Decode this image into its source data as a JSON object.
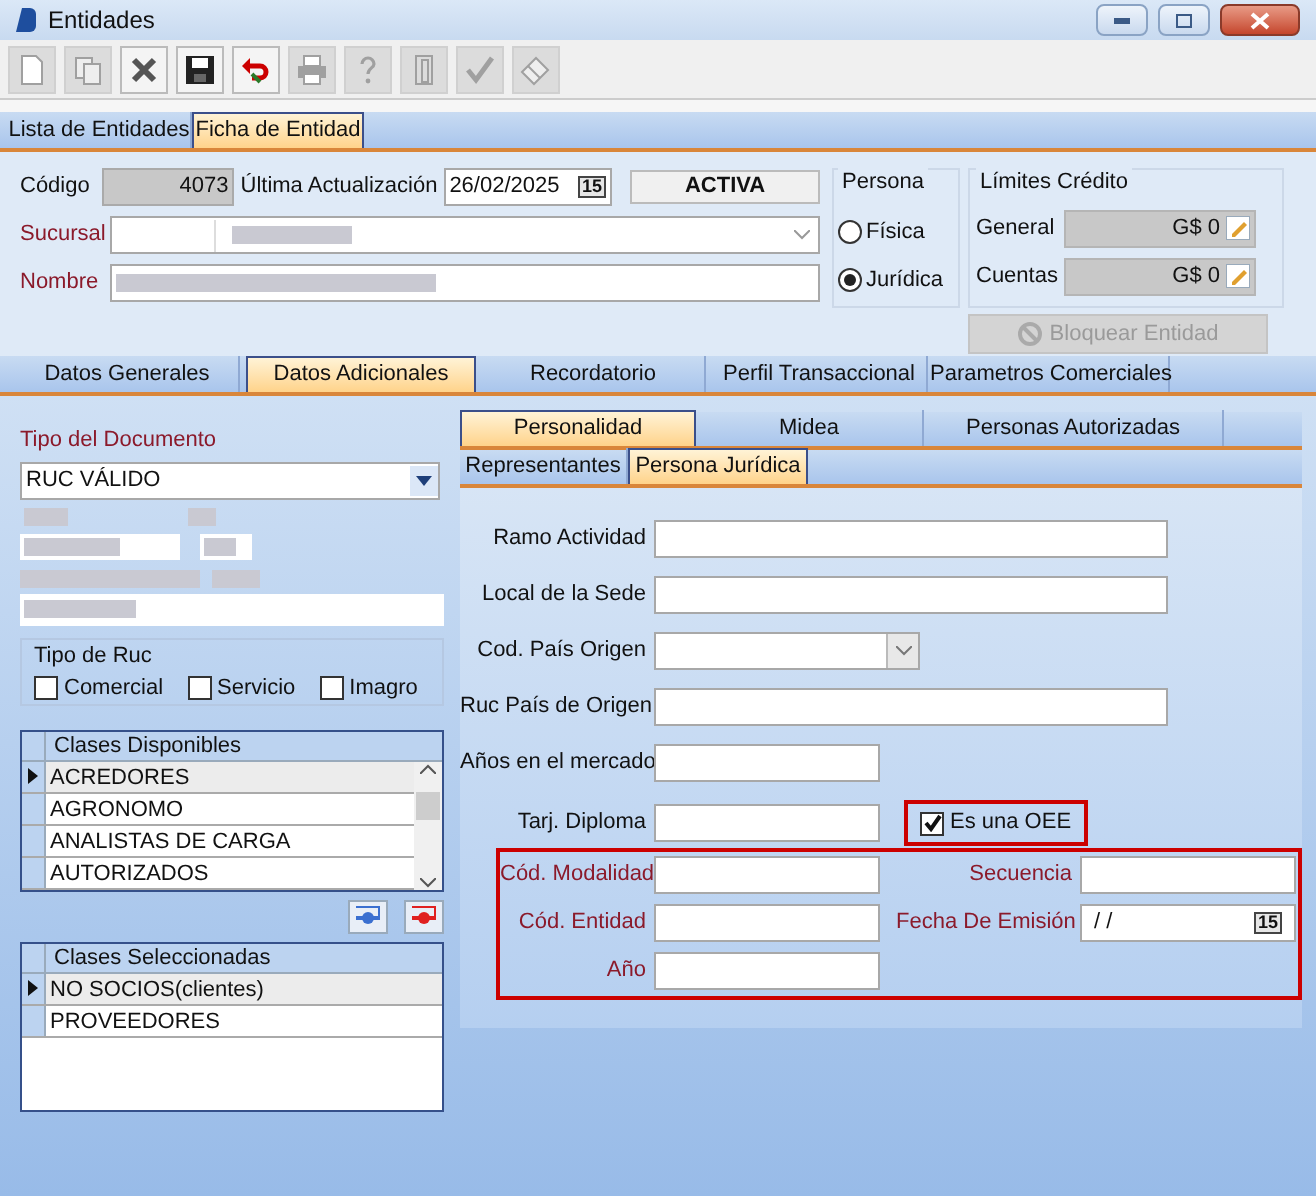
{
  "window": {
    "title": "Entidades",
    "controls": [
      {
        "kind": "minimize"
      },
      {
        "kind": "maximize"
      },
      {
        "kind": "close"
      }
    ]
  },
  "toolbar": [
    {
      "kind": "new",
      "disabled": true
    },
    {
      "kind": "copy",
      "disabled": true
    },
    {
      "kind": "delete",
      "disabled": false
    },
    {
      "kind": "save",
      "disabled": false
    },
    {
      "kind": "undo",
      "disabled": false
    },
    {
      "kind": "print",
      "disabled": true
    },
    {
      "kind": "help",
      "disabled": true
    },
    {
      "kind": "exit",
      "disabled": true
    },
    {
      "kind": "accept",
      "disabled": true
    },
    {
      "kind": "erase",
      "disabled": true
    }
  ],
  "form_tabs": [
    {
      "label": "Lista de Entidades",
      "selected": false
    },
    {
      "label": "Ficha de Entidad",
      "selected": true
    }
  ],
  "header": {
    "codigo": {
      "label": "Código",
      "value": "4073"
    },
    "ultima_actualizacion": {
      "label": "Última Actualización",
      "value": "26/02/2025",
      "calendar": "15"
    },
    "status": "ACTIVA",
    "sucursal": {
      "label": "Sucursal",
      "required": true
    },
    "nombre": {
      "label": "Nombre",
      "required": true
    }
  },
  "persona": {
    "title": "Persona",
    "options": [
      {
        "label": "Física",
        "selected": false
      },
      {
        "label": "Jurídica",
        "selected": true
      }
    ]
  },
  "limites_credito": {
    "title": "Límites Crédito",
    "rows": [
      {
        "label": "General",
        "value": "G$ 0"
      },
      {
        "label": "Cuentas",
        "value": "G$ 0"
      }
    ]
  },
  "bloquear_button": {
    "label": "Bloquear Entidad",
    "disabled": true
  },
  "section_tabs": [
    {
      "label": "Datos Generales",
      "selected": false
    },
    {
      "label": "Datos Adicionales",
      "selected": true
    },
    {
      "label": "Recordatorio",
      "selected": false
    },
    {
      "label": "Perfil Transaccional",
      "selected": false
    },
    {
      "label": "Parametros Comerciales",
      "selected": false
    }
  ],
  "datos_adicionales": {
    "tipo_documento": {
      "label": "Tipo del Documento",
      "value": "RUC VÁLIDO",
      "required": true
    },
    "tipo_de_ruc": {
      "title": "Tipo de Ruc",
      "options": [
        {
          "label": "Comercial",
          "checked": false
        },
        {
          "label": "Servicio",
          "checked": false
        },
        {
          "label": "Imagro",
          "checked": false
        }
      ]
    },
    "clases_disponibles": {
      "header": "Clases Disponibles",
      "rows": [
        {
          "label": "ACREDORES",
          "selected": true
        },
        {
          "label": "AGRONOMO",
          "selected": false
        },
        {
          "label": "ANALISTAS DE CARGA",
          "selected": false
        },
        {
          "label": "AUTORIZADOS",
          "selected": false
        }
      ]
    },
    "clases_seleccionadas": {
      "header": "Clases Seleccionadas",
      "rows": [
        {
          "label": "NO SOCIOS(clientes)",
          "selected": true
        },
        {
          "label": "PROVEEDORES",
          "selected": false
        }
      ]
    }
  },
  "sub_tabs": [
    {
      "label": "Personalidad",
      "selected": true
    },
    {
      "label": "Midea",
      "selected": false
    },
    {
      "label": "Personas Autorizadas",
      "selected": false
    }
  ],
  "inner_tabs": [
    {
      "label": "Representantes",
      "selected": false
    },
    {
      "label": "Persona Jurídica",
      "selected": true
    }
  ],
  "persona_juridica": {
    "fields": [
      {
        "label": "Ramo Actividad",
        "kind": "long"
      },
      {
        "label": "Local de la Sede",
        "kind": "long"
      },
      {
        "label": "Cod. País Origen",
        "kind": "combo"
      },
      {
        "label": "Ruc País de Origen",
        "kind": "long"
      },
      {
        "label": "Años en el mercado",
        "kind": "short"
      },
      {
        "label": "Tarj. Diploma",
        "kind": "short"
      }
    ],
    "oee_checkbox": {
      "label": "Es una OEE",
      "checked": true,
      "highlighted": true
    },
    "oee_fields": {
      "highlighted": true,
      "left": [
        {
          "label": "Cód. Modalidad",
          "required": true
        },
        {
          "label": "Cód. Entidad",
          "required": true
        },
        {
          "label": "Año",
          "required": true
        }
      ],
      "right": [
        {
          "label": "Secuencia",
          "kind": "text",
          "required": true
        },
        {
          "label": "Fecha De Emisión",
          "kind": "date",
          "value": "/ /",
          "calendar": "15",
          "required": true
        }
      ]
    }
  }
}
